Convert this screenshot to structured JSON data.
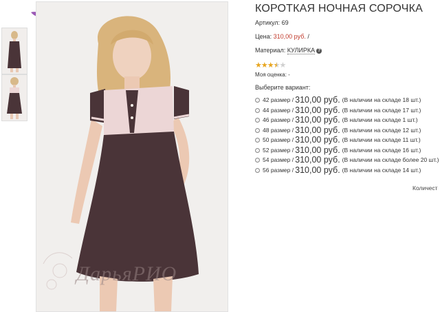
{
  "product": {
    "title": "КОРОТКАЯ НОЧНАЯ СОРОЧКА",
    "sku_label": "Артикул:",
    "sku_value": "69",
    "price_label": "Цена:",
    "price_value": "310,00 руб.",
    "price_sep": "/",
    "material_label": "Материал:",
    "material_value": "КУЛИРКА",
    "rating": {
      "value": 3.5,
      "max": 5
    },
    "my_rating_label": "Моя оценка:",
    "my_rating_value": "-",
    "choose_label": "Выберите вариант:",
    "quantity_label": "Количест"
  },
  "variants": [
    {
      "size": "42 размер",
      "sep": "/",
      "price": "310,00 руб.",
      "stock": "(В наличии на складе 18 шт.)"
    },
    {
      "size": "44 размер",
      "sep": "/",
      "price": "310,00 руб.",
      "stock": "(В наличии на складе 17 шт.)"
    },
    {
      "size": "46 размер",
      "sep": "/",
      "price": "310,00 руб.",
      "stock": "(В наличии на складе 1 шт.)"
    },
    {
      "size": "48 размер",
      "sep": "/",
      "price": "310,00 руб.",
      "stock": "(В наличии на складе 12 шт.)"
    },
    {
      "size": "50 размер",
      "sep": "/",
      "price": "310,00 руб.",
      "stock": "(В наличии на складе 11 шт.)"
    },
    {
      "size": "52 размер",
      "sep": "/",
      "price": "310,00 руб.",
      "stock": "(В наличии на складе 16 шт.)"
    },
    {
      "size": "54 размер",
      "sep": "/",
      "price": "310,00 руб.",
      "stock": "(В наличии на складе более 20 шт.)"
    },
    {
      "size": "56 размер",
      "sep": "/",
      "price": "310,00 руб.",
      "stock": "(В наличии на складе 14 шт.)"
    }
  ],
  "watermark": {
    "text": "ДарьяРИО"
  },
  "colors": {
    "accent_price": "#c0392b",
    "dress_brown": "#4a3438",
    "dress_pink": "#ecd6d6",
    "star": "#e8a620"
  }
}
